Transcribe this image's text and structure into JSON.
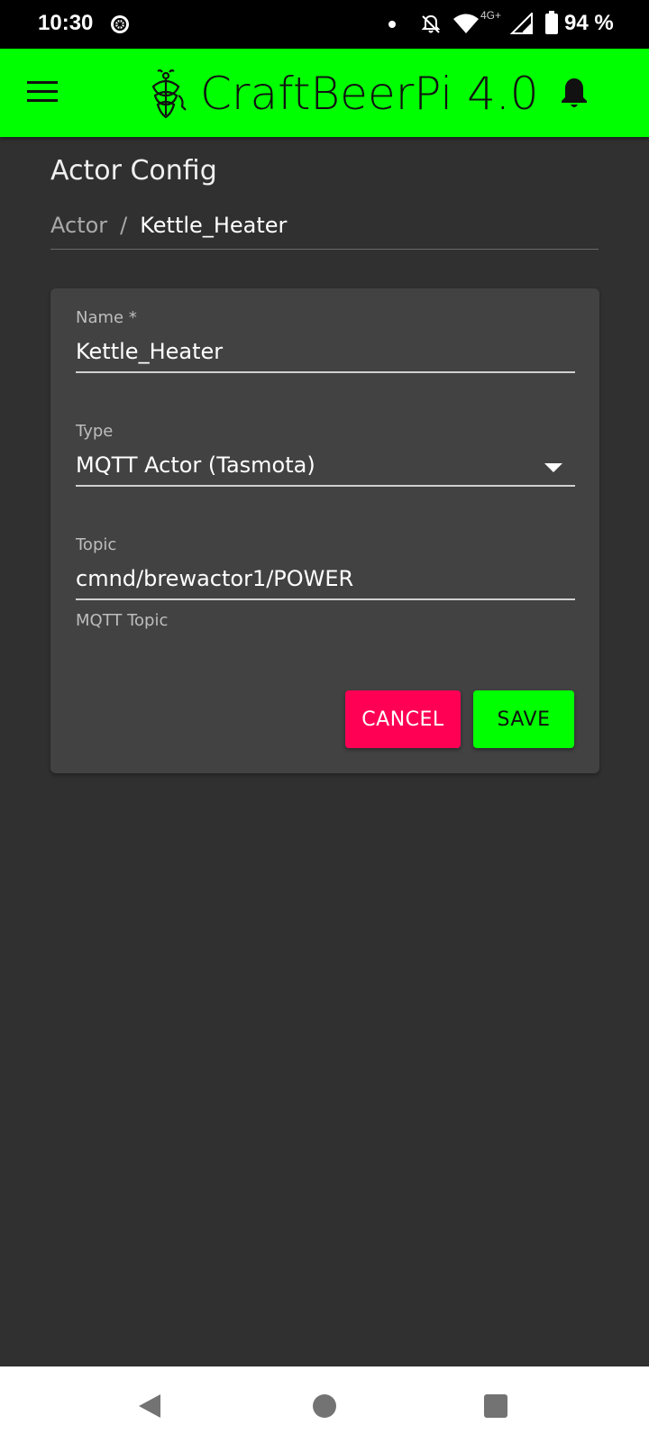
{
  "status_bar": {
    "time": "10:30",
    "network": "4G+",
    "battery": "94 %"
  },
  "app_bar": {
    "title": "CraftBeerPi 4.0",
    "background_color": "#00ff00"
  },
  "page": {
    "title": "Actor Config",
    "breadcrumb": {
      "root": "Actor",
      "separator": "/",
      "current": "Kettle_Heater"
    }
  },
  "form": {
    "name": {
      "label": "Name *",
      "value": "Kettle_Heater"
    },
    "type": {
      "label": "Type",
      "value": "MQTT Actor (Tasmota)"
    },
    "topic": {
      "label": "Topic",
      "value": "cmnd/brewactor1/POWER",
      "helper": "MQTT Topic"
    }
  },
  "buttons": {
    "cancel": "CANCEL",
    "save": "SAVE",
    "cancel_color": "#ff0055",
    "save_color": "#00ff00"
  },
  "icons": {
    "menu": "hamburger-menu-icon",
    "logo": "hop-icon",
    "notifications": "bell-icon",
    "back": "back-triangle-icon",
    "home": "home-circle-icon",
    "recents": "recents-square-icon"
  }
}
